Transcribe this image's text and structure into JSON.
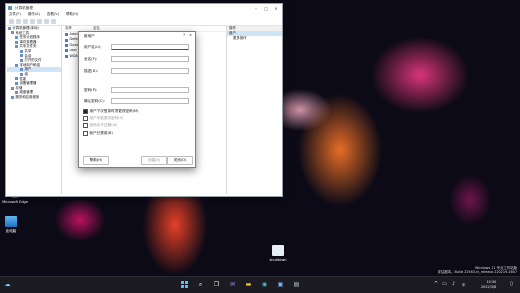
{
  "window": {
    "title": "计算机管理",
    "menu": [
      "文件(F)",
      "操作(A)",
      "查看(V)",
      "帮助(H)"
    ]
  },
  "tree": [
    {
      "label": "计算机管理(本地)",
      "level": 0
    },
    {
      "label": "系统工具",
      "level": 1
    },
    {
      "label": "任务计划程序",
      "level": 2
    },
    {
      "label": "事件查看器",
      "level": 2
    },
    {
      "label": "共享文件夹",
      "level": 2
    },
    {
      "label": "共享",
      "level": 3
    },
    {
      "label": "会话",
      "level": 3
    },
    {
      "label": "打开的文件",
      "level": 3
    },
    {
      "label": "本地用户和组",
      "level": 2
    },
    {
      "label": "用户",
      "level": 3,
      "selected": true
    },
    {
      "label": "组",
      "level": 3
    },
    {
      "label": "性能",
      "level": 2
    },
    {
      "label": "设备管理器",
      "level": 2
    },
    {
      "label": "存储",
      "level": 1
    },
    {
      "label": "磁盘管理",
      "level": 2
    },
    {
      "label": "服务和应用程序",
      "level": 1
    }
  ],
  "list": {
    "header": [
      "名称",
      "全名"
    ],
    "items": [
      "Administrator",
      "DefaultAccount",
      "Guest",
      "user",
      "WDAGUtilityAccount"
    ]
  },
  "actions": {
    "title": "操作",
    "section": "用户",
    "item": "更多操作"
  },
  "dialog": {
    "title": "新用户",
    "help": "?",
    "close": "×",
    "username_label": "用户名(U):",
    "fullname_label": "全名(F):",
    "desc_label": "描述(D):",
    "password_label": "密码(P):",
    "confirm_label": "确认密码(C):",
    "cb_must_change": "用户下次登录时须更改密码(M)",
    "cb_cannot_change": "用户不能更改密码(S)",
    "cb_never_expire": "密码永不过期(W)",
    "cb_disabled": "帐户已禁用(B)",
    "btn_help": "帮助(H)",
    "btn_create": "创建(E)",
    "btn_close": "关闭(O)"
  },
  "desktop": {
    "icons": [
      "Microsoft Edge",
      "此电脑",
      "shutdown"
    ],
    "watermark_line1": "Windows 11 专业工作站版",
    "watermark_line2": "评估副本。Build 22563.ni_release.220219-1607"
  },
  "taskbar": {
    "lang": "中",
    "time": "10:30",
    "date": "2022/3/8"
  },
  "colors": {
    "accent": "#0b5fbd",
    "selection": "#cde5f7",
    "taskbar": "#1c1b22"
  }
}
